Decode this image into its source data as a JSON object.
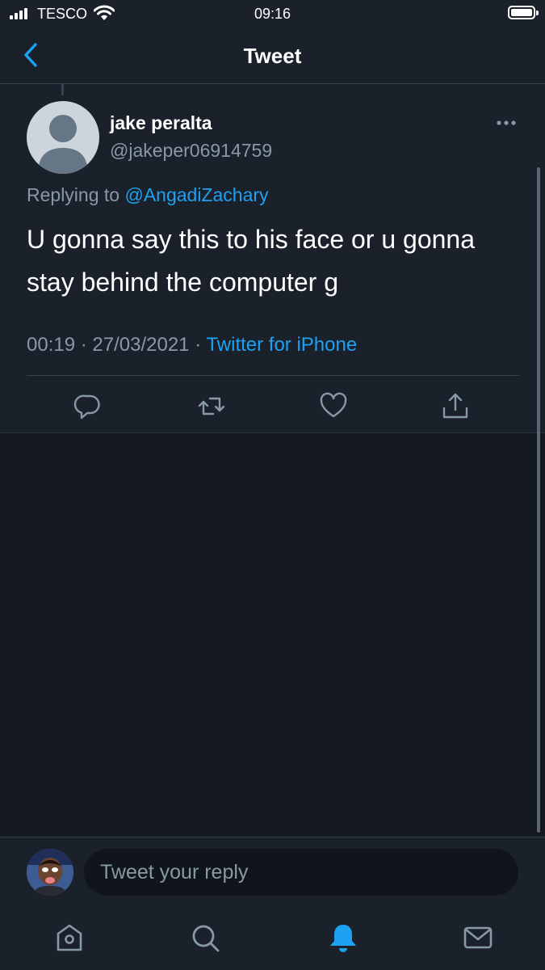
{
  "status_bar": {
    "carrier": "TESCO",
    "time": "09:16"
  },
  "header": {
    "title": "Tweet",
    "back_icon": "chevron-left-icon"
  },
  "tweet": {
    "display_name": "jake peralta",
    "handle": "@jakeper06914759",
    "replying_prefix": "Replying to",
    "replying_to": "@AngadiZachary",
    "text": "U gonna say this to his face or u gonna stay behind the computer g",
    "time": "00:19",
    "separator": "·",
    "date": "27/03/2021",
    "source": "Twitter for iPhone",
    "actions": [
      "reply-icon",
      "retweet-icon",
      "like-icon",
      "share-icon"
    ]
  },
  "reply_box": {
    "placeholder": "Tweet your reply"
  },
  "tab_bar": {
    "tabs": [
      "home-icon",
      "search-icon",
      "notifications-icon",
      "messages-icon"
    ],
    "active": "notifications-icon"
  },
  "colors": {
    "background": "#141921",
    "surface": "#1a212b",
    "accent": "#1da1f2",
    "secondary_text": "#8899a6",
    "border": "#38444d"
  }
}
